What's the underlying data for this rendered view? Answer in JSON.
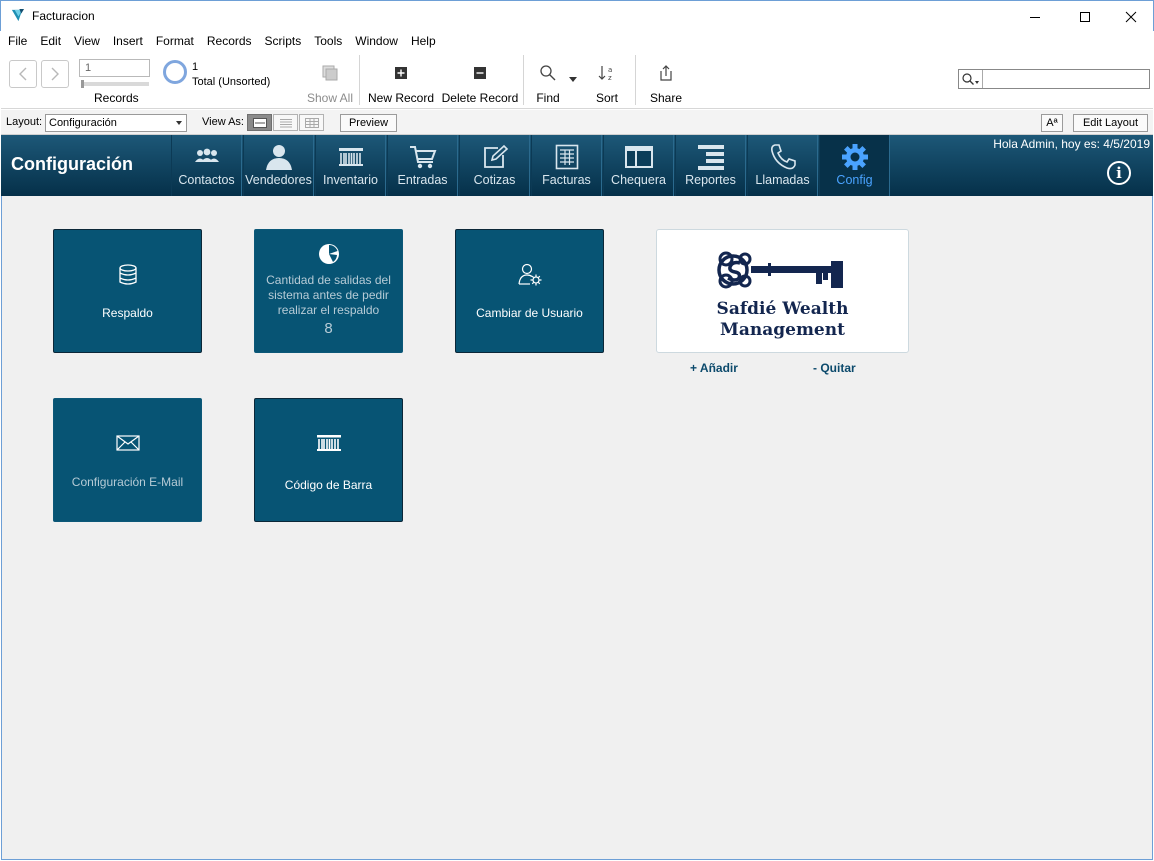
{
  "window": {
    "title": "Facturacion"
  },
  "menu": [
    "File",
    "Edit",
    "View",
    "Insert",
    "Format",
    "Records",
    "Scripts",
    "Tools",
    "Window",
    "Help"
  ],
  "toolbar": {
    "record_number": "1",
    "records_label": "Records",
    "found_count": "1",
    "found_label": "Total (Unsorted)",
    "show_all": "Show All",
    "new_record": "New Record",
    "delete_record": "Delete Record",
    "find": "Find",
    "sort": "Sort",
    "share": "Share",
    "search_value": ""
  },
  "layoutbar": {
    "layout_label": "Layout:",
    "layout_value": "Configuración",
    "view_as_label": "View As:",
    "preview": "Preview",
    "text_format": "Aª",
    "edit_layout": "Edit Layout"
  },
  "header": {
    "page_title": "Configuración",
    "greeting": "Hola Admin, hoy es: 4/5/2019",
    "tabs": [
      "Contactos",
      "Vendedores",
      "Inventario",
      "Entradas",
      "Cotizas",
      "Facturas",
      "Chequera",
      "Reportes",
      "Llamadas",
      "Config"
    ],
    "active_tab": "Config"
  },
  "tiles": {
    "backup": "Respaldo",
    "exits_text": "Cantidad de salidas del sistema antes de pedir realizar el respaldo",
    "exits_value": "8",
    "change_user": "Cambiar de Usuario",
    "email_config": "Configuración E-Mail",
    "barcode": "Código de Barra"
  },
  "logo": {
    "line1": "Safdié Wealth",
    "line2": "Management",
    "add": "+ Añadir",
    "remove": "- Quitar"
  },
  "colors": {
    "tile": "#075474",
    "header": "#053049",
    "active_tab_text": "#4aa3ff"
  }
}
